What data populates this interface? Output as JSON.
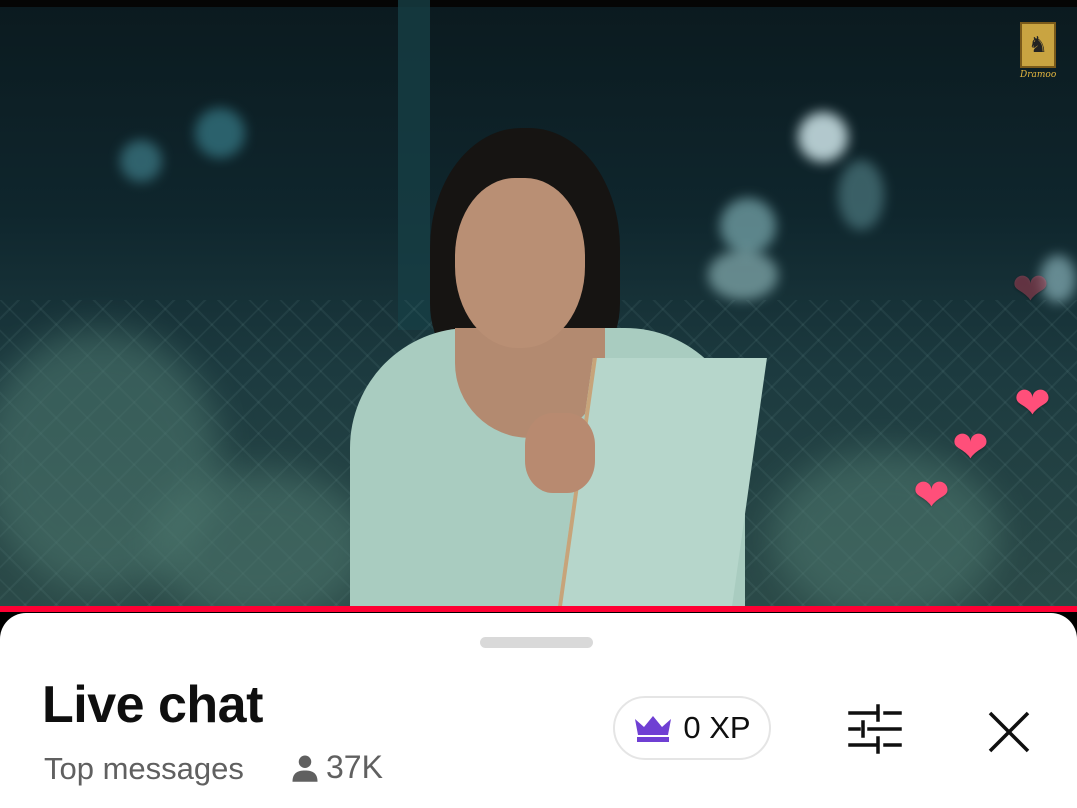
{
  "video": {
    "logo_text": "Dramoo",
    "progress_fraction": 1.0,
    "colors": {
      "progress": "#ff0033",
      "heart": "#ff4f7a"
    }
  },
  "chat": {
    "title": "Live chat",
    "mode": "Top messages",
    "viewer_count": "37K",
    "xp_label": "0 XP",
    "icons": {
      "viewers": "person-icon",
      "xp": "crown-icon",
      "filter": "sliders-icon",
      "close": "close-icon"
    },
    "colors": {
      "crown": "#6f3fd3"
    }
  }
}
